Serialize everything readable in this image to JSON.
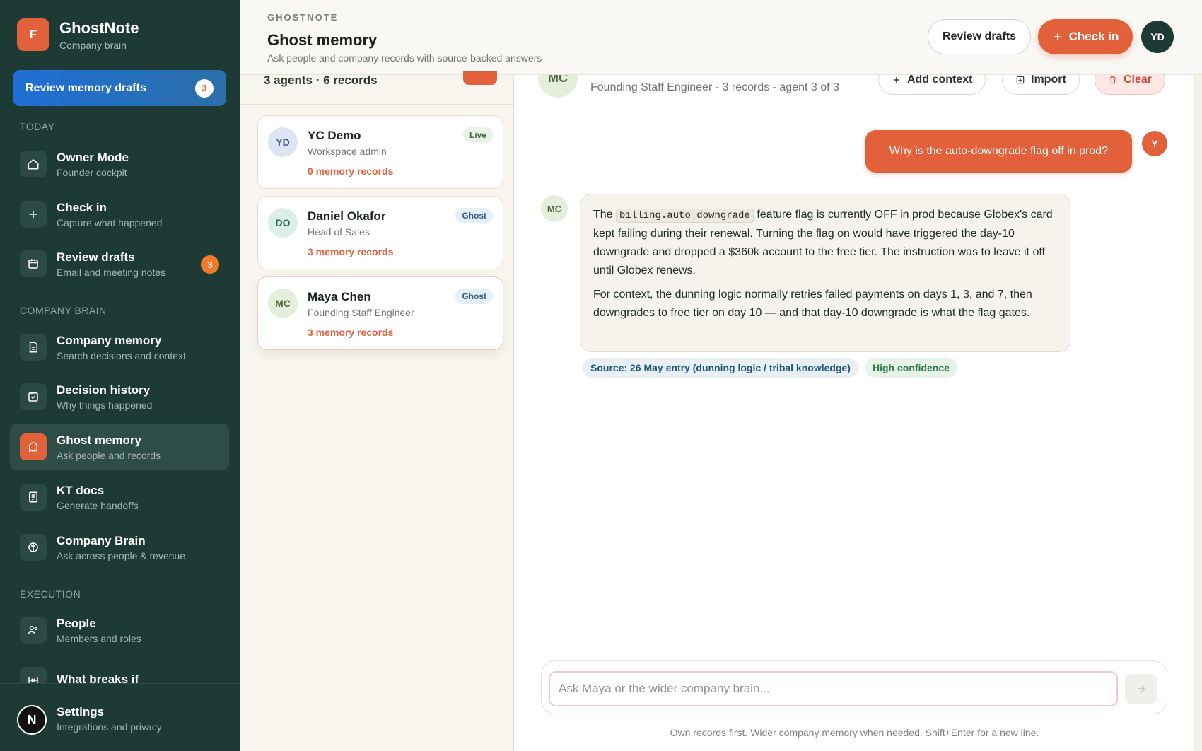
{
  "sidebar": {
    "brand": {
      "initial": "F",
      "name": "GhostNote",
      "sub": "Company brain"
    },
    "review_cta": {
      "label": "Review memory drafts",
      "count": "3"
    },
    "sections": {
      "today": "TODAY",
      "company_brain": "COMPANY BRAIN",
      "execution": "EXECUTION"
    },
    "items": [
      {
        "title": "Owner Mode",
        "sub": "Founder cockpit",
        "icon": "home-icon"
      },
      {
        "title": "Check in",
        "sub": "Capture what happened",
        "icon": "plus-icon"
      },
      {
        "title": "Review drafts",
        "sub": "Email and meeting notes",
        "icon": "calendar-icon",
        "badge": "3"
      },
      {
        "title": "Company memory",
        "sub": "Search decisions and context",
        "icon": "document-icon"
      },
      {
        "title": "Decision history",
        "sub": "Why things happened",
        "icon": "calendar-check-icon"
      },
      {
        "title": "Ghost memory",
        "sub": "Ask people and records",
        "icon": "ghost-icon",
        "active": true
      },
      {
        "title": "KT docs",
        "sub": "Generate handoffs",
        "icon": "doc-lines-icon"
      },
      {
        "title": "Company Brain",
        "sub": "Ask across people & revenue",
        "icon": "brain-icon"
      },
      {
        "title": "People",
        "sub": "Members and roles",
        "icon": "people-icon"
      },
      {
        "title": "What breaks if",
        "sub": "",
        "icon": "network-icon"
      }
    ],
    "footer": {
      "avatar": "N",
      "title": "Settings",
      "sub": "Integrations and privacy"
    }
  },
  "header": {
    "eyebrow": "GHOSTNOTE",
    "title": "Ghost memory",
    "subtitle": "Ask people and company records with source-backed answers",
    "review_label": "Review drafts",
    "checkin_label": "Check in",
    "avatar": "YD"
  },
  "agents": {
    "summary": "3 agents · 6 records",
    "list": [
      {
        "initials": "YD",
        "name": "YC Demo",
        "role": "Workspace admin",
        "records": "0 memory records",
        "tag": "Live"
      },
      {
        "initials": "DO",
        "name": "Daniel Okafor",
        "role": "Head of Sales",
        "records": "3 memory records",
        "tag": "Ghost"
      },
      {
        "initials": "MC",
        "name": "Maya Chen",
        "role": "Founding Staff Engineer",
        "records": "3 memory records",
        "tag": "Ghost",
        "selected": true
      }
    ]
  },
  "chat": {
    "header": {
      "avatar": "MC",
      "sub": "Founding Staff Engineer - 3 records - agent 3 of 3",
      "add_context": "Add context",
      "import": "Import",
      "clear": "Clear"
    },
    "user_message": "Why is the auto-downgrade flag off in prod?",
    "user_avatar": "Y",
    "ai_avatar": "MC",
    "ai_message": {
      "p1_before": "The",
      "p1_code": "billing.auto_downgrade",
      "p1_after": "feature flag is currently OFF in prod because Globex's card kept failing during their renewal. Turning the flag on would have triggered the day-10 downgrade and dropped a $360k account to the free tier. The instruction was to leave it off until Globex renews.",
      "p2": "For context, the dunning logic normally retries failed payments on days 1, 3, and 7, then downgrades to free tier on day 10 — and that day-10 downgrade is what the flag gates."
    },
    "source": "Source: 26 May entry (dunning logic / tribal knowledge)",
    "confidence": "High confidence",
    "composer": {
      "placeholder": "Ask Maya or the wider company brain...",
      "hint": "Own records first. Wider company memory when needed. Shift+Enter for a new line."
    }
  },
  "colors": {
    "accent": "#e2603a",
    "sidebar": "#1d3b34",
    "cta_blue": "#1f6fd6"
  }
}
